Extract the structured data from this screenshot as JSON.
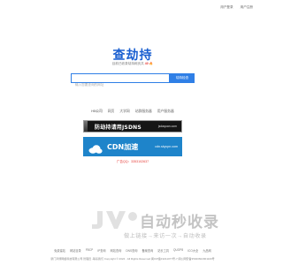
{
  "top_links": [
    "用户登录",
    "用户注册"
  ],
  "logo": {
    "text": "查劫持"
  },
  "subtitle": {
    "before": "目前已收录劫持网页共",
    "count": "40",
    "flame": "🔥"
  },
  "search": {
    "placeholder": "输入您要查询的网址",
    "button_label": "劫持检查"
  },
  "categories": [
    "H5公司",
    "网页",
    "大学网",
    "站群服务器",
    "用户服务器"
  ],
  "ads": {
    "banner1": {
      "text": "防劫持请用JSDNS",
      "url": "jsdaquan.com",
      "bg": "#151515"
    },
    "banner2": {
      "text": "CDN加速",
      "url": "cdn.skyvpn.com",
      "bg": "#1e84ca"
    },
    "contact": "广告QQ：3353102637"
  },
  "watermark": {
    "logo_text": "自动秒收录",
    "tagline": "做上链接→来访一次→自动收录"
  },
  "footer": {
    "links": [
      "免费建站",
      "网站目录",
      "FBCP",
      "IP查询",
      "网站查询",
      "DNS查询",
      "备案查询",
      "站长工具",
      "QUOP8",
      "ICO大全",
      "九品网"
    ],
    "copyright": "厦门鸿博网络科技有限公司    管理员 -联系我们    Copyright © 2024 · All Rights Reserved    闽ICP备19211077号-7    闽公网安备35020602001100号"
  },
  "colors": {
    "brand_blue": "#2f7fe6",
    "accent_red": "#e53935"
  }
}
